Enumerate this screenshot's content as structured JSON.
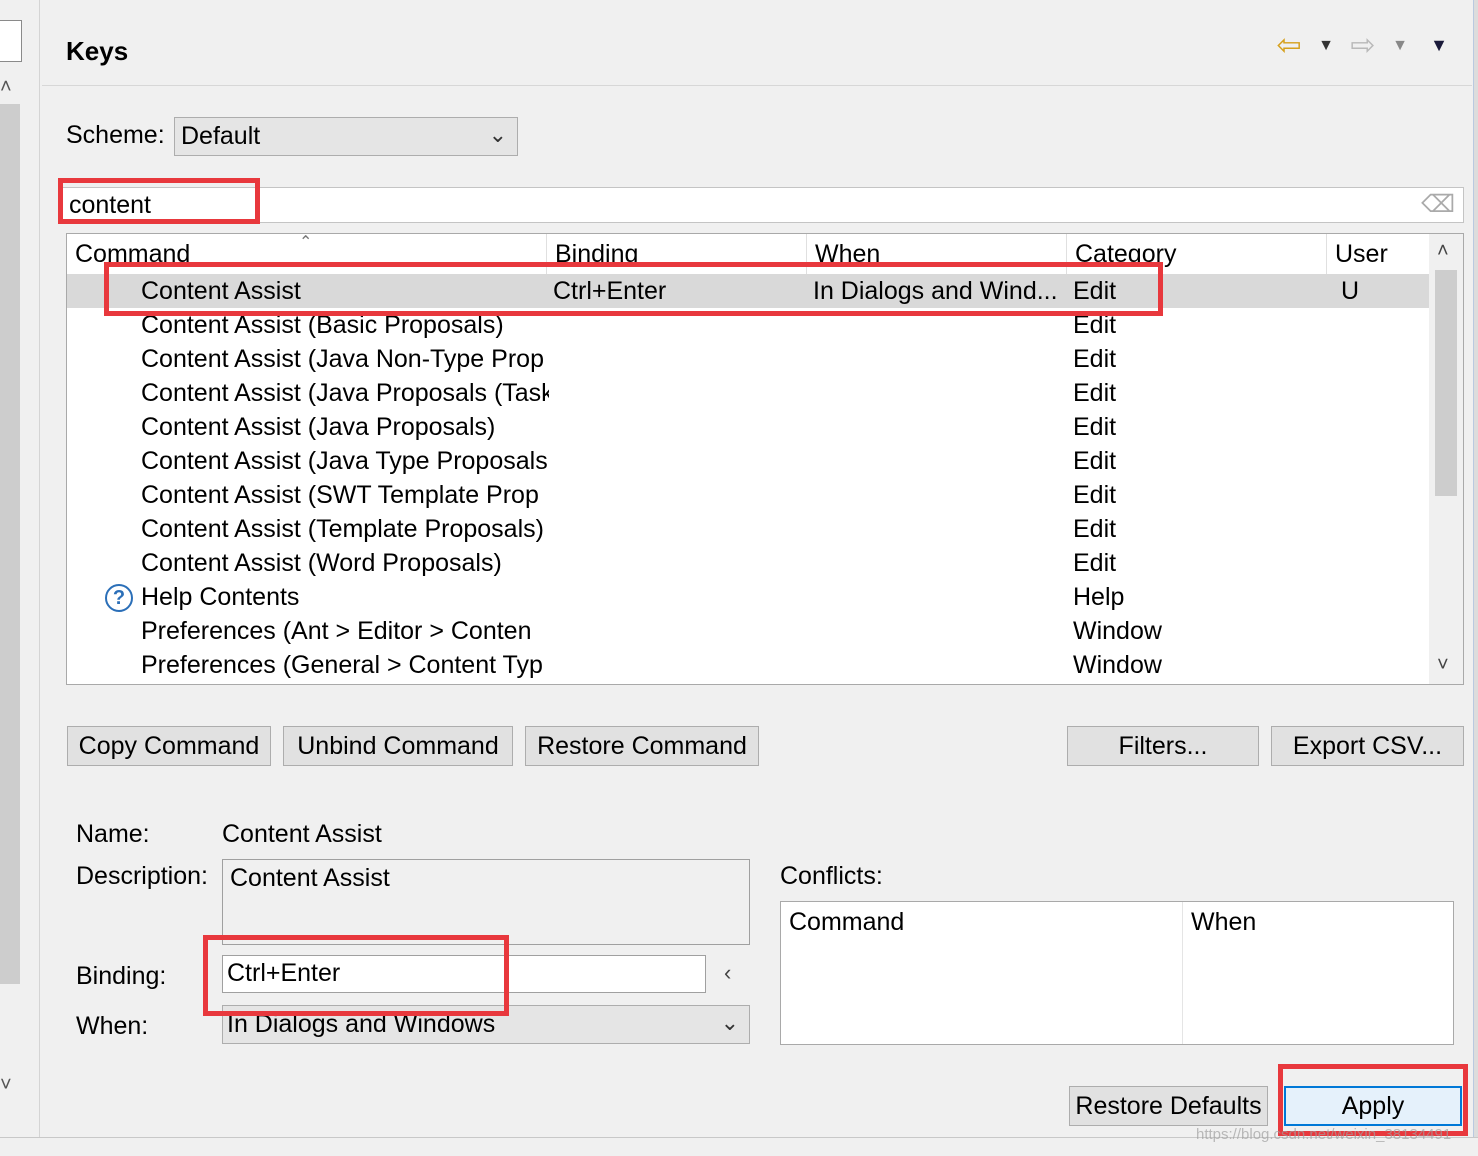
{
  "header": {
    "title": "Keys"
  },
  "scheme": {
    "label": "Scheme:",
    "value": "Default"
  },
  "filter": {
    "value": "content"
  },
  "table": {
    "columns": [
      "Command",
      "Binding",
      "When",
      "Category",
      "User"
    ],
    "rows": [
      {
        "command": "Content Assist",
        "binding": "Ctrl+Enter",
        "when": "In Dialogs and Wind...",
        "category": "Edit",
        "user": "U"
      },
      {
        "command": "Content Assist (Basic Proposals)",
        "binding": "",
        "when": "",
        "category": "Edit",
        "user": ""
      },
      {
        "command": "Content Assist (Java Non-Type Prop",
        "binding": "",
        "when": "",
        "category": "Edit",
        "user": ""
      },
      {
        "command": "Content Assist (Java Proposals (Task",
        "binding": "",
        "when": "",
        "category": "Edit",
        "user": ""
      },
      {
        "command": "Content Assist (Java Proposals)",
        "binding": "",
        "when": "",
        "category": "Edit",
        "user": ""
      },
      {
        "command": "Content Assist (Java Type Proposals",
        "binding": "",
        "when": "",
        "category": "Edit",
        "user": ""
      },
      {
        "command": "Content Assist (SWT Template Prop",
        "binding": "",
        "when": "",
        "category": "Edit",
        "user": ""
      },
      {
        "command": "Content Assist (Template Proposals)",
        "binding": "",
        "when": "",
        "category": "Edit",
        "user": ""
      },
      {
        "command": "Content Assist (Word Proposals)",
        "binding": "",
        "when": "",
        "category": "Edit",
        "user": ""
      },
      {
        "command": "Help Contents",
        "binding": "",
        "when": "",
        "category": "Help",
        "user": ""
      },
      {
        "command": "Preferences (Ant > Editor > Conten",
        "binding": "",
        "when": "",
        "category": "Window",
        "user": ""
      },
      {
        "command": "Preferences (General > Content Typ",
        "binding": "",
        "when": "",
        "category": "Window",
        "user": ""
      }
    ]
  },
  "buttons": {
    "copy": "Copy Command",
    "unbind": "Unbind Command",
    "restore": "Restore Command",
    "filters": "Filters...",
    "export": "Export CSV...",
    "restore_defaults": "Restore Defaults",
    "apply": "Apply"
  },
  "details": {
    "name_label": "Name:",
    "name_value": "Content Assist",
    "description_label": "Description:",
    "description_value": "Content Assist",
    "binding_label": "Binding:",
    "binding_value": "Ctrl+Enter",
    "when_label": "When:",
    "when_value": "In Dialogs and Windows"
  },
  "conflicts": {
    "label": "Conflicts:",
    "columns": [
      "Command",
      "When"
    ]
  },
  "watermark": "https://blog.csdn.net/weixin_38134491",
  "colors": {
    "highlight": "#e8383d",
    "selected_row": "#d9d9d9",
    "back_arrow": "#d6a01c"
  }
}
